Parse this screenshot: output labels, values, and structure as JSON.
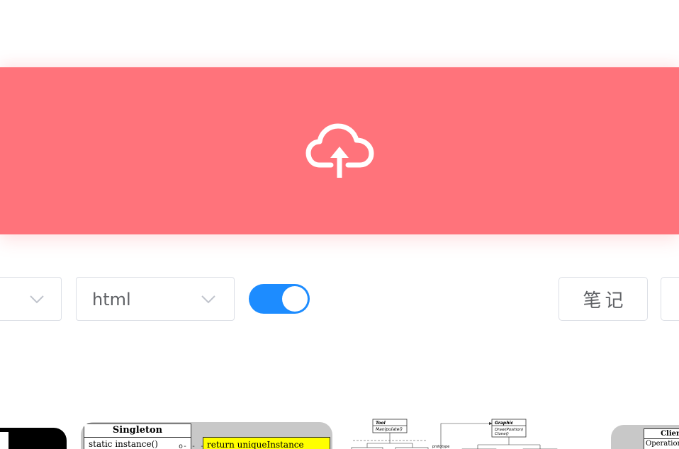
{
  "upload": {
    "icon": "cloud-upload-icon",
    "color": "#ff737b"
  },
  "toolbar": {
    "language_select": {
      "value": "html",
      "icon": "chevron-down-icon"
    },
    "left_select": {
      "icon": "chevron-down-icon"
    },
    "toggle": {
      "on": true,
      "color": "#1d8cff"
    },
    "notes_label": "笔记"
  },
  "thumbnails": {
    "singleton": {
      "title": "Singleton",
      "method": "static instance()",
      "note": "return uniqueInstance"
    },
    "graphic": {
      "tool_title": "Tool",
      "tool_method": "Manipulate()",
      "graphic_title": "Graphic",
      "graphic_method1": "Draw(Position)",
      "graphic_method2": "Clone()",
      "prototype_label": "prototype"
    },
    "client": {
      "title": "Client",
      "method": "Operation("
    }
  }
}
